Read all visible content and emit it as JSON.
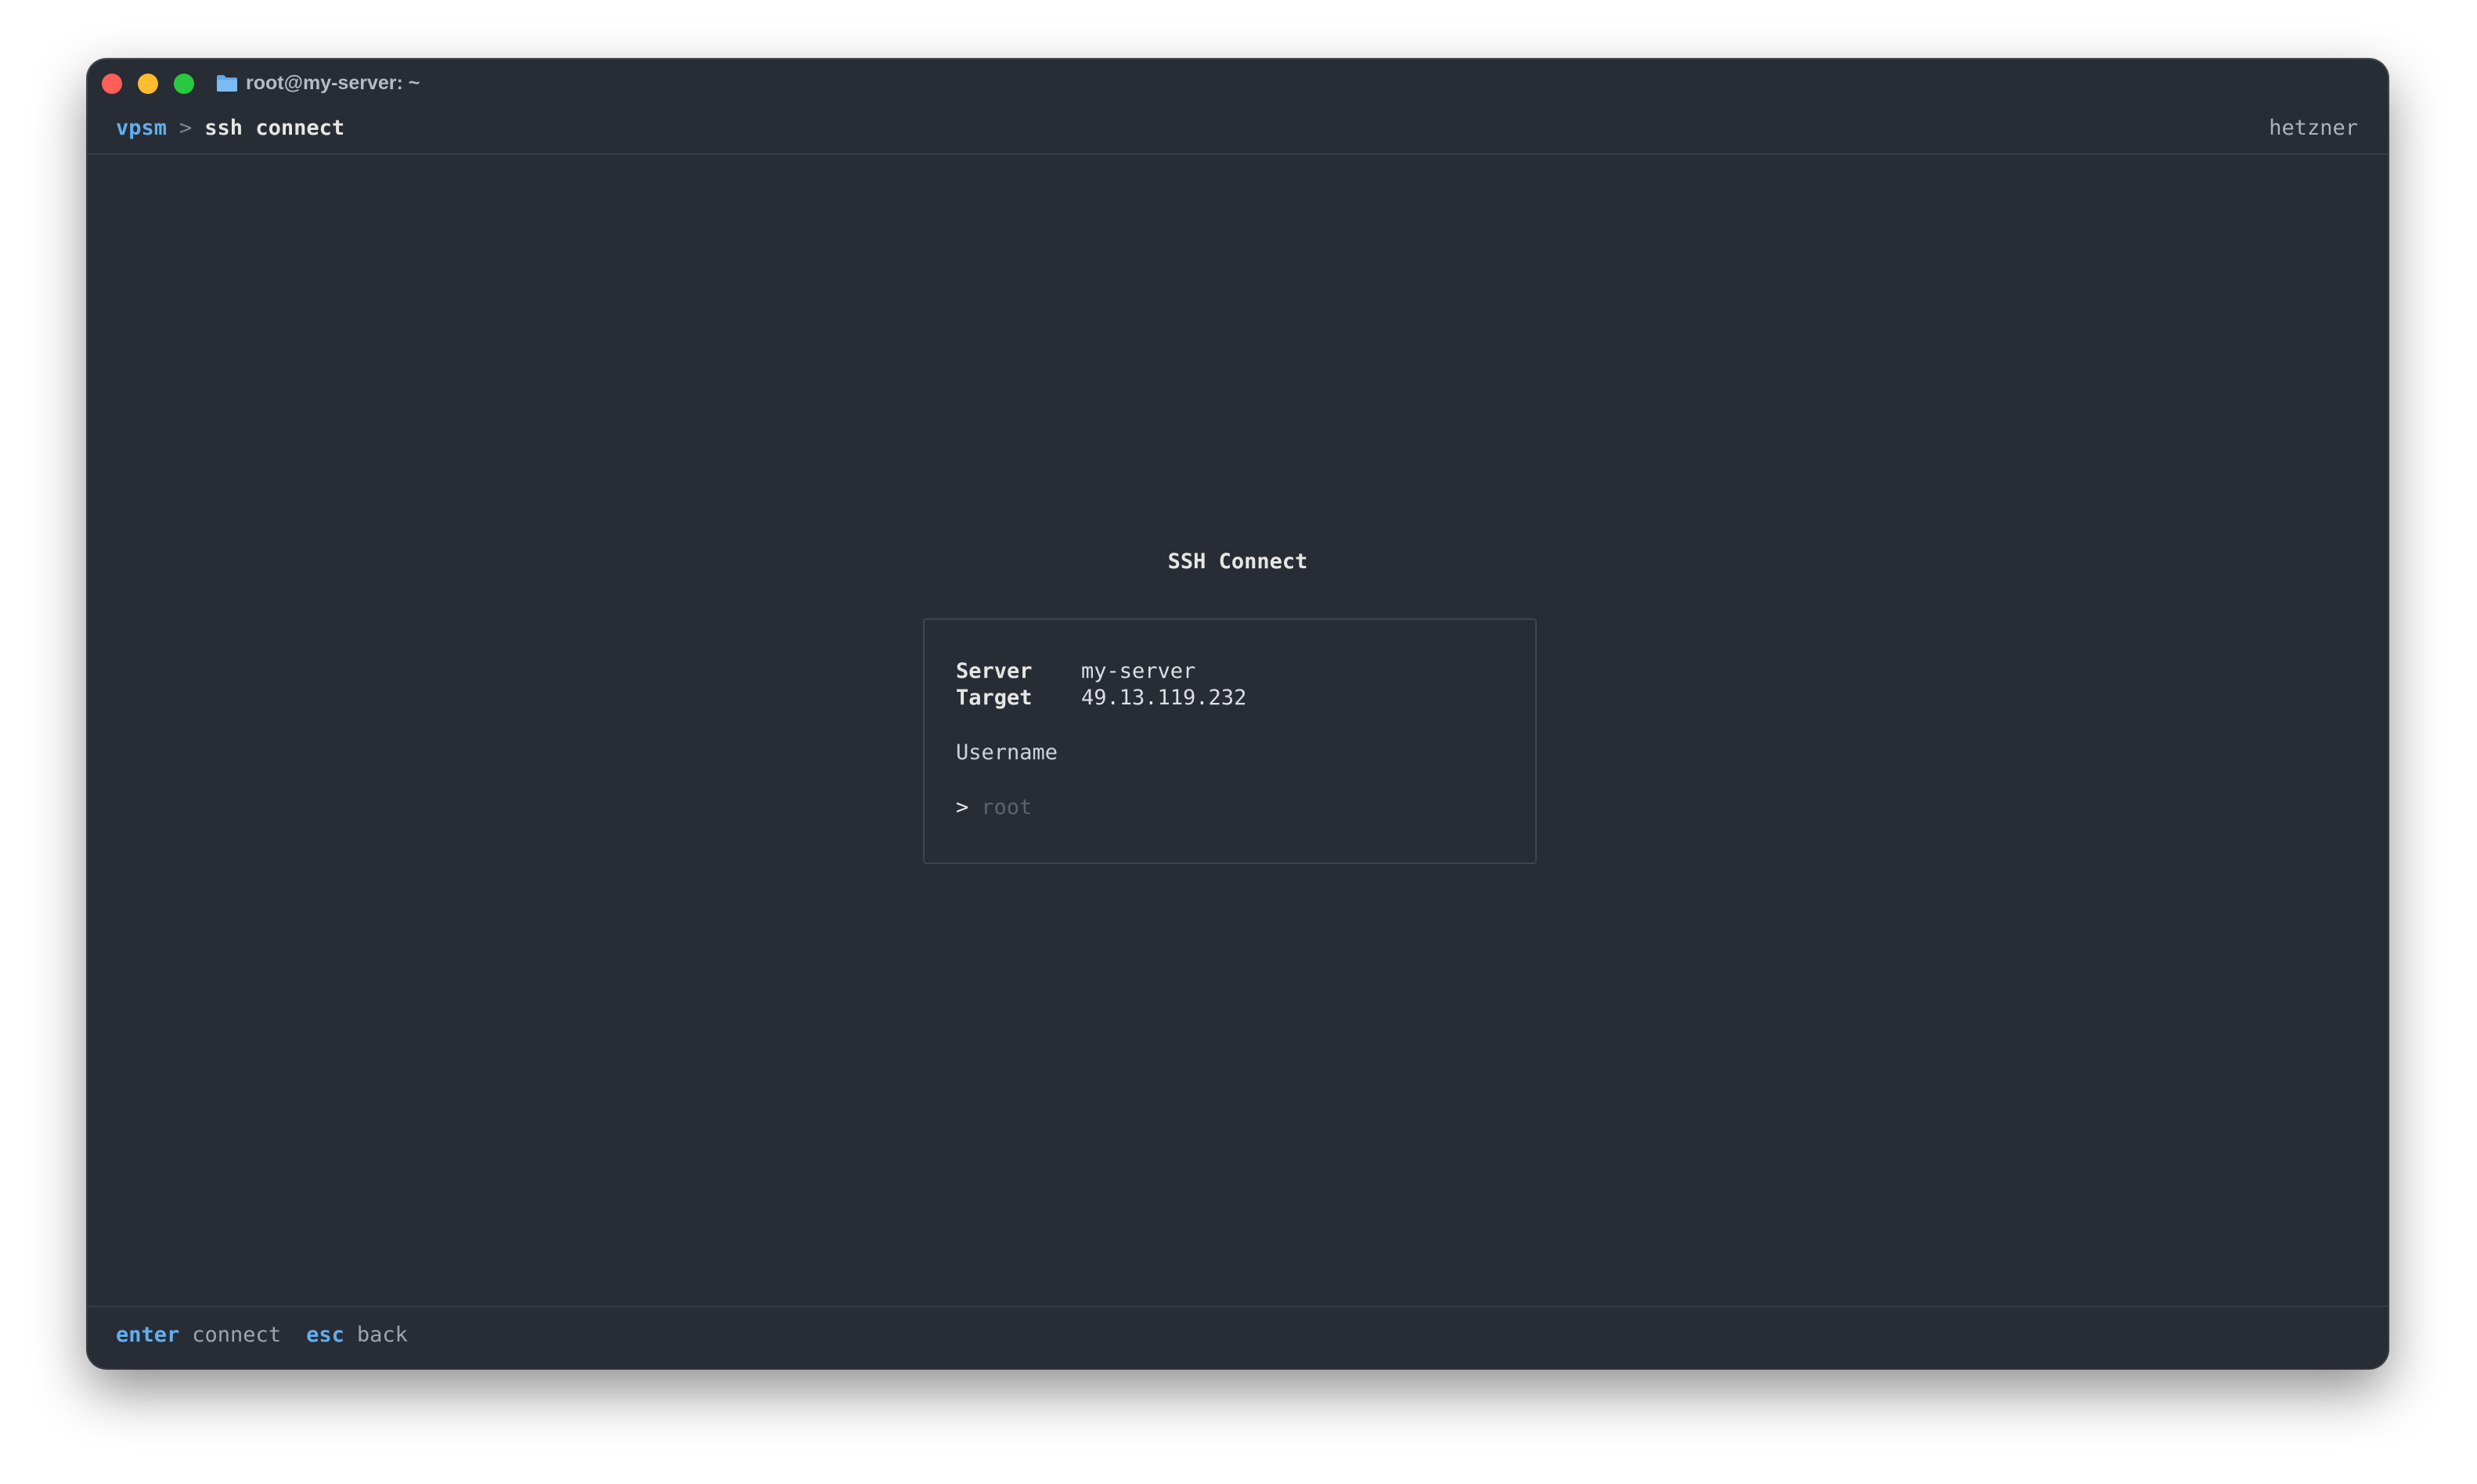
{
  "window": {
    "title": "root@my-server: ~",
    "folder_icon": "folder-icon"
  },
  "header": {
    "breadcrumb": {
      "root": "vpsm",
      "separator": ">",
      "current": "ssh connect"
    },
    "provider": "hetzner"
  },
  "dialog": {
    "title": "SSH Connect",
    "fields": [
      {
        "label": "Server",
        "value": "my-server"
      },
      {
        "label": "Target",
        "value": "49.13.119.232"
      }
    ],
    "username_label": "Username",
    "prompt": ">",
    "username_placeholder": "root",
    "username_value": ""
  },
  "footer": {
    "hints": [
      {
        "key": "enter",
        "action": "connect"
      },
      {
        "key": "esc",
        "action": "back"
      }
    ]
  },
  "colors": {
    "background": "#282c34",
    "accent": "#61afef",
    "close": "#ff5f57",
    "minimize": "#febc2e",
    "maximize": "#28c840"
  }
}
